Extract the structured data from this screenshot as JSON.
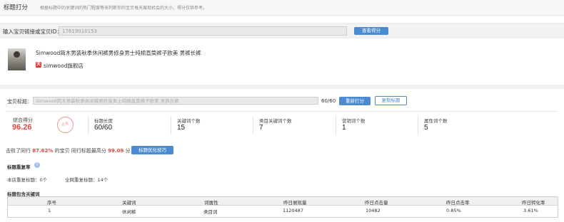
{
  "header": {
    "title": "标题打分",
    "description": "根据标题中的关键词的热门程度等来判断你的宝贝每天展现机会的大小，得分仅供参考。"
  },
  "search": {
    "label": "输入宝贝链接或宝贝ID：",
    "value": "17619010153",
    "button_label": "查看得分"
  },
  "product": {
    "title": "Simwood简木男装秋季休闲裤男修身男士纯棉直筒裤子欧美 男裤长裤",
    "shop_icon": "天",
    "shop_name": "simwood旗舰店"
  },
  "title_edit": {
    "label": "宝贝标题：",
    "value": "Simwood简木男装秋季休闲裤男修身男士纯棉直筒裤子欧美 男裤长裤",
    "count": "60/60",
    "refresh_label": "重新打分",
    "copy_label": "复制标题"
  },
  "score": {
    "label": "综合得分",
    "value": "96.26",
    "stamp": "优秀"
  },
  "stats": [
    {
      "label": "标题长度",
      "value": "60/60"
    },
    {
      "label": "关键词个数",
      "value": "15"
    },
    {
      "label": "类目关键词个数",
      "value": "7"
    },
    {
      "label": "营销词个数",
      "value": "1"
    },
    {
      "label": "属性词个数",
      "value": "5"
    }
  ],
  "beat": {
    "prefix": "击败了同行",
    "percent": "87.62%",
    "middle": "的宝贝 同行标题最高分",
    "top_score": "99.09",
    "suffix": "分",
    "tips_label": "标题优化技巧"
  },
  "duplicate": {
    "title": "标题重复率",
    "shop_label": "本店重复标题：0个",
    "net_label": "全网重复标题：14个"
  },
  "keywords": {
    "title": "标题包含关键词",
    "headers": [
      "序号",
      "关键词",
      "词属性",
      "昨日展现量",
      "昨日点击量",
      "昨日点击率",
      "昨日转化率"
    ],
    "rows": [
      [
        "1",
        "休闲裤",
        "类目词",
        "1120487",
        "10482",
        "0.85%",
        "3.61%"
      ]
    ]
  },
  "colors": {
    "accent_blue": "#4a8bd1",
    "score_red": "#e8473d"
  }
}
